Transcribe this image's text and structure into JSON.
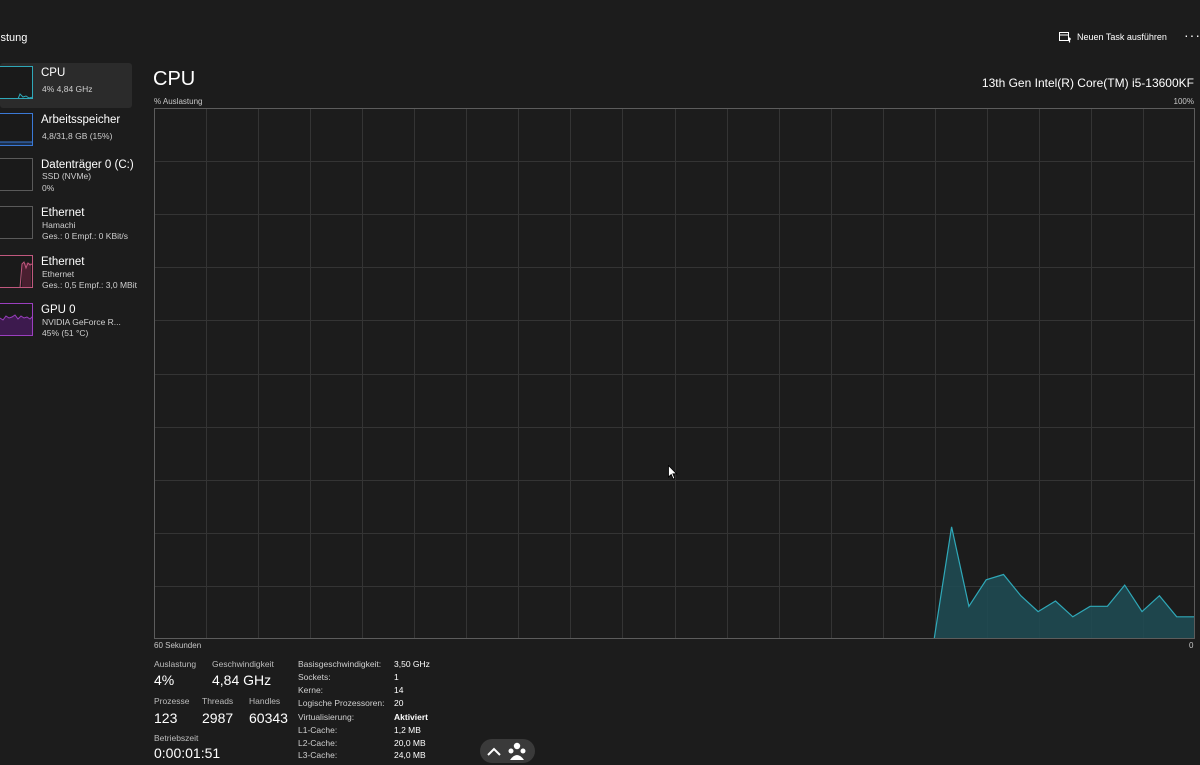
{
  "header": {
    "title": "istung",
    "new_task_label": "Neuen Task ausführen",
    "more_label": "···"
  },
  "sidebar": {
    "items": [
      {
        "name": "CPU",
        "line1": "4% 4,84 GHz",
        "line2": "",
        "active": true,
        "accent": "#2fa8b8"
      },
      {
        "name": "Arbeitsspeicher",
        "line1": "4,8/31,8 GB (15%)",
        "line2": "",
        "active": false,
        "accent": "#3b79d6"
      },
      {
        "name": "Datenträger 0 (C:)",
        "line1": "SSD (NVMe)",
        "line2": "0%",
        "active": false,
        "accent": "#6fae3a"
      },
      {
        "name": "Ethernet",
        "line1": "Hamachi",
        "line2": "Ges.: 0 Empf.: 0 KBit/s",
        "active": false,
        "accent": "#c0587e"
      },
      {
        "name": "Ethernet",
        "line1": "Ethernet",
        "line2": "Ges.: 0,5 Empf.: 3,0 MBit",
        "active": false,
        "accent": "#c0587e"
      },
      {
        "name": "GPU 0",
        "line1": "NVIDIA GeForce R...",
        "line2": "45% (51 °C)",
        "active": false,
        "accent": "#9b3fbf"
      }
    ]
  },
  "main": {
    "title": "CPU",
    "model": "13th Gen Intel(R) Core(TM) i5-13600KF",
    "y_axis_label": "% Auslastung",
    "y_axis_max_label": "100%",
    "x_axis_left_label": "60 Sekunden",
    "x_axis_right_label": "0"
  },
  "chart_data": {
    "type": "area",
    "x_label": "60 Sekunden",
    "y_label": "% Auslastung",
    "xlim": [
      60,
      0
    ],
    "ylim": [
      0,
      100
    ],
    "x": [
      60,
      59,
      58,
      57,
      56,
      55,
      54,
      53,
      52,
      51,
      50,
      49,
      48,
      47,
      46,
      45,
      44,
      43,
      42,
      41,
      40,
      39,
      38,
      37,
      36,
      35,
      34,
      33,
      32,
      31,
      30,
      29,
      28,
      27,
      26,
      25,
      24,
      23,
      22,
      21,
      20,
      19,
      18,
      17,
      16,
      15,
      14,
      13,
      12,
      11,
      10,
      9,
      8,
      7,
      6,
      5,
      4,
      3,
      2,
      1,
      0
    ],
    "values": [
      0,
      0,
      0,
      0,
      0,
      0,
      0,
      0,
      0,
      0,
      0,
      0,
      0,
      0,
      0,
      0,
      0,
      0,
      0,
      0,
      0,
      0,
      0,
      0,
      0,
      0,
      0,
      0,
      0,
      0,
      0,
      0,
      0,
      0,
      0,
      0,
      0,
      0,
      0,
      0,
      0,
      0,
      0,
      0,
      0,
      0,
      21,
      6,
      11,
      12,
      8,
      5,
      7,
      4,
      6,
      6,
      10,
      5,
      8,
      4,
      4
    ],
    "grid": true,
    "line_color": "#2fa8b8",
    "fill_color": "#1f4a52"
  },
  "stats": {
    "utilization_label": "Auslastung",
    "utilization_value": "4%",
    "speed_label": "Geschwindigkeit",
    "speed_value": "4,84 GHz",
    "processes_label": "Prozesse",
    "processes_value": "123",
    "threads_label": "Threads",
    "threads_value": "2987",
    "handles_label": "Handles",
    "handles_value": "60343",
    "uptime_label": "Betriebszeit",
    "uptime_value": "0:00:01:51"
  },
  "details": [
    {
      "label": "Basisgeschwindigkeit:",
      "value": "3,50 GHz"
    },
    {
      "label": "Sockets:",
      "value": "1"
    },
    {
      "label": "Kerne:",
      "value": "14"
    },
    {
      "label": "Logische Prozessoren:",
      "value": "20"
    },
    {
      "label": "Virtualisierung:",
      "value": "Aktiviert"
    },
    {
      "label": "L1-Cache:",
      "value": "1,2 MB"
    },
    {
      "label": "L2-Cache:",
      "value": "20,0 MB"
    },
    {
      "label": "L3-Cache:",
      "value": "24,0 MB"
    }
  ]
}
